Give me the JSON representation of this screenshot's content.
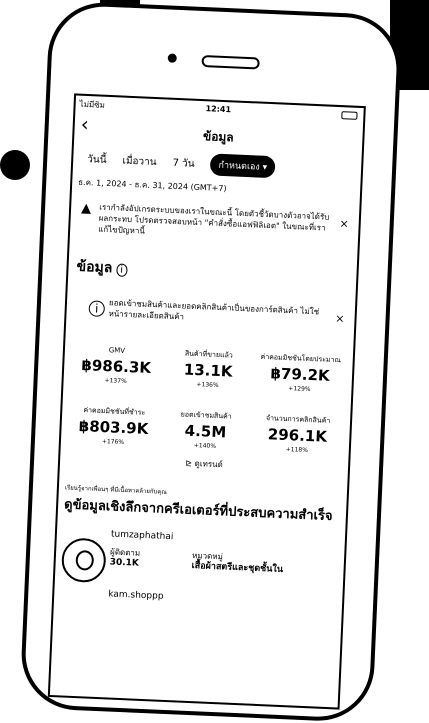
{
  "status_bar": {
    "carrier": "ไม่มีซิม",
    "time": "12:41"
  },
  "header": {
    "back": "‹",
    "title": "ข้อมูล"
  },
  "tabs": [
    {
      "label": "วันนี้"
    },
    {
      "label": "เมื่อวาน"
    },
    {
      "label": "7 วัน"
    },
    {
      "label": "กำหนดเอง"
    }
  ],
  "date_range": "ธ.ค. 1, 2024 - ธ.ค. 31, 2024 (GMT+7)",
  "banner_warning": {
    "text": "เรากำลังอัปเกรดระบบของเราในขณะนี้ โดยตัวชี้วัดบางตัวอาจได้รับผลกระทบ โปรดตรวจสอบหน้า \"คำสั่งซื้อแอฟฟิลิเอต\" ในขณะที่เราแก้ไขปัญหานี้",
    "close": "×"
  },
  "section_title": "ข้อมูล",
  "banner_info": {
    "text": "ยอดเข้าชมสินค้าและยอดคลิกสินค้าเป็นของการ์ดสินค้า ไม่ใช่หน้ารายละเอียดสินค้า",
    "close": "×"
  },
  "metrics": [
    {
      "label": "GMV",
      "value": "฿986.3K",
      "change": "+137%"
    },
    {
      "label": "สินค้าที่ขายแล้ว",
      "value": "13.1K",
      "change": "+136%"
    },
    {
      "label": "ค่าคอมมิชชันโดยประมาณ",
      "value": "฿79.2K",
      "change": "+129%"
    },
    {
      "label": "ค่าคอมมิชชันที่ชำระ",
      "value": "฿803.9K",
      "change": "+176%"
    },
    {
      "label": "ยอดเข้าชมสินค้า",
      "value": "4.5M",
      "change": "+140%"
    },
    {
      "label": "จำนวนการคลิกสินค้า",
      "value": "296.1K",
      "change": "+118%"
    }
  ],
  "trend_link": "ดูเทรนด์",
  "insight": {
    "subtitle": "เรียนรู้จากเพื่อนๆ ที่มีเนื้อหาคล้ายกับคุณ",
    "title": "ดูข้อมูลเชิงลึกจากครีเอเตอร์ที่ประสบความสำเร็จ"
  },
  "creator": {
    "name": "tumzaphathai",
    "followers_label": "ผู้ติดตาม",
    "followers_value": "30.1K",
    "category_label": "หมวดหมู่",
    "category_value": "เสื้อผ้าสตรีและชุดชั้นใน"
  },
  "creator_next": {
    "name": "kam.shoppp"
  }
}
